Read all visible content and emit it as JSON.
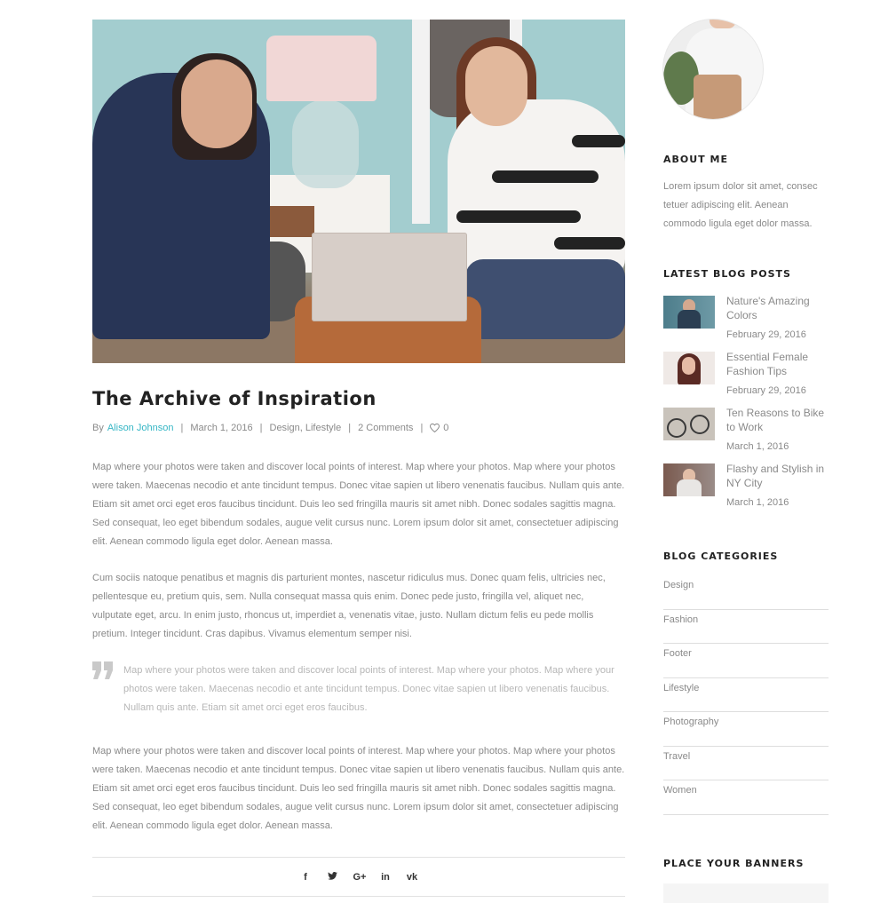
{
  "post": {
    "title": "The Archive of Inspiration",
    "meta": {
      "by_label": "By",
      "author": "Alison Johnson",
      "date": "March 1, 2016",
      "categories": "Design, Lifestyle",
      "comments": "2 Comments",
      "likes": "0",
      "separator": "|"
    },
    "paragraphs": [
      "Map where your photos were taken and discover local points of interest. Map where your photos. Map where your photos were taken. Maecenas necodio et ante tincidunt tempus. Donec vitae sapien ut libero venenatis faucibus. Nullam quis ante. Etiam sit amet orci eget eros faucibus tincidunt. Duis leo sed fringilla mauris sit amet nibh. Donec sodales sagittis magna. Sed consequat, leo eget bibendum sodales, augue velit cursus nunc. Lorem ipsum dolor sit amet, consectetuer adipiscing elit. Aenean commodo ligula eget dolor. Aenean massa.",
      "Cum sociis natoque penatibus et magnis dis parturient montes, nascetur ridiculus mus. Donec quam felis, ultricies nec, pellentesque eu, pretium quis, sem. Nulla consequat massa quis enim. Donec pede justo, fringilla vel, aliquet nec, vulputate eget, arcu. In enim justo, rhoncus ut, imperdiet a, venenatis vitae, justo. Nullam dictum felis eu pede mollis pretium. Integer tincidunt. Cras dapibus. Vivamus elementum semper nisi."
    ],
    "quote": "Map where your photos were taken and discover local points of interest. Map where your photos. Map where your photos were taken. Maecenas necodio et ante tincidunt tempus. Donec vitae sapien ut libero venenatis faucibus. Nullam quis ante. Etiam sit amet orci eget eros faucibus.",
    "paragraph_after_quote": "Map where your photos were taken and discover local points of interest. Map where your photos. Map where your photos were taken. Maecenas necodio et ante tincidunt tempus. Donec vitae sapien ut libero venenatis faucibus. Nullam quis ante. Etiam sit amet orci eget eros faucibus tincidunt. Duis leo sed fringilla mauris sit amet nibh. Donec sodales sagittis magna. Sed consequat, leo eget bibendum sodales, augue velit cursus nunc. Lorem ipsum dolor sit amet, consectetuer adipiscing elit. Aenean commodo ligula eget dolor. Aenean massa."
  },
  "share": {
    "facebook": "f",
    "twitter": "🐦",
    "google_plus": "G+",
    "linkedin": "in",
    "vk": "vk"
  },
  "sidebar": {
    "about": {
      "title": "About Me",
      "text": "Lorem ipsum dolor sit amet, consec tetuer adipiscing elit. Aenean commodo ligula eget dolor massa."
    },
    "latest": {
      "title": "Latest Blog Posts",
      "posts": [
        {
          "title": "Nature's Amazing Colors",
          "date": "February 29, 2016"
        },
        {
          "title": "Essential Female Fashion Tips",
          "date": "February 29, 2016"
        },
        {
          "title": "Ten Reasons to Bike to Work",
          "date": "March 1, 2016"
        },
        {
          "title": "Flashy and Stylish in NY City",
          "date": "March 1, 2016"
        }
      ]
    },
    "categories": {
      "title": "Blog Categories",
      "items": [
        "Design",
        "Fashion",
        "Footer",
        "Lifestyle",
        "Photography",
        "Travel",
        "Women"
      ]
    },
    "banners": {
      "title": "Place Your Banners"
    }
  },
  "colors": {
    "accent": "#35b6c5",
    "heading": "#222222",
    "body_text": "#8a8a8a",
    "quote_text": "#b7b7b7",
    "divider": "#dedede"
  }
}
